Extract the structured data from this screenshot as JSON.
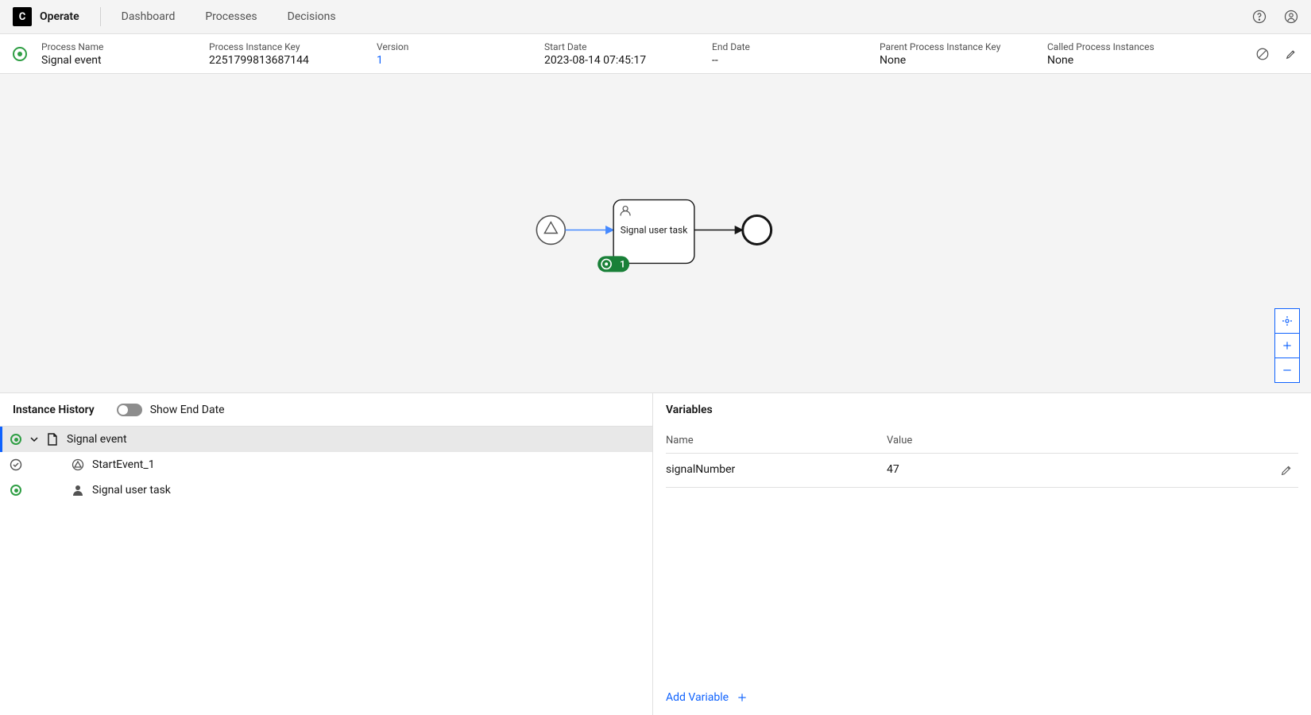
{
  "header": {
    "brand_letter": "C",
    "brand_title": "Operate",
    "nav": [
      "Dashboard",
      "Processes",
      "Decisions"
    ]
  },
  "instance": {
    "process_name_label": "Process Name",
    "process_name": "Signal event",
    "key_label": "Process Instance Key",
    "key": "2251799813687144",
    "version_label": "Version",
    "version": "1",
    "start_label": "Start Date",
    "start": "2023-08-14 07:45:17",
    "end_label": "End Date",
    "end": "--",
    "parent_label": "Parent Process Instance Key",
    "parent": "None",
    "called_label": "Called Process Instances",
    "called": "None"
  },
  "diagram": {
    "task_label": "Signal user task",
    "badge_count": "1"
  },
  "history": {
    "panel_title": "Instance History",
    "toggle_label": "Show End Date",
    "rows": [
      {
        "label": "Signal event"
      },
      {
        "label": "StartEvent_1"
      },
      {
        "label": "Signal user task"
      }
    ]
  },
  "variables": {
    "panel_title": "Variables",
    "col_name": "Name",
    "col_value": "Value",
    "rows": [
      {
        "name": "signalNumber",
        "value": "47"
      }
    ],
    "add_label": "Add Variable"
  }
}
